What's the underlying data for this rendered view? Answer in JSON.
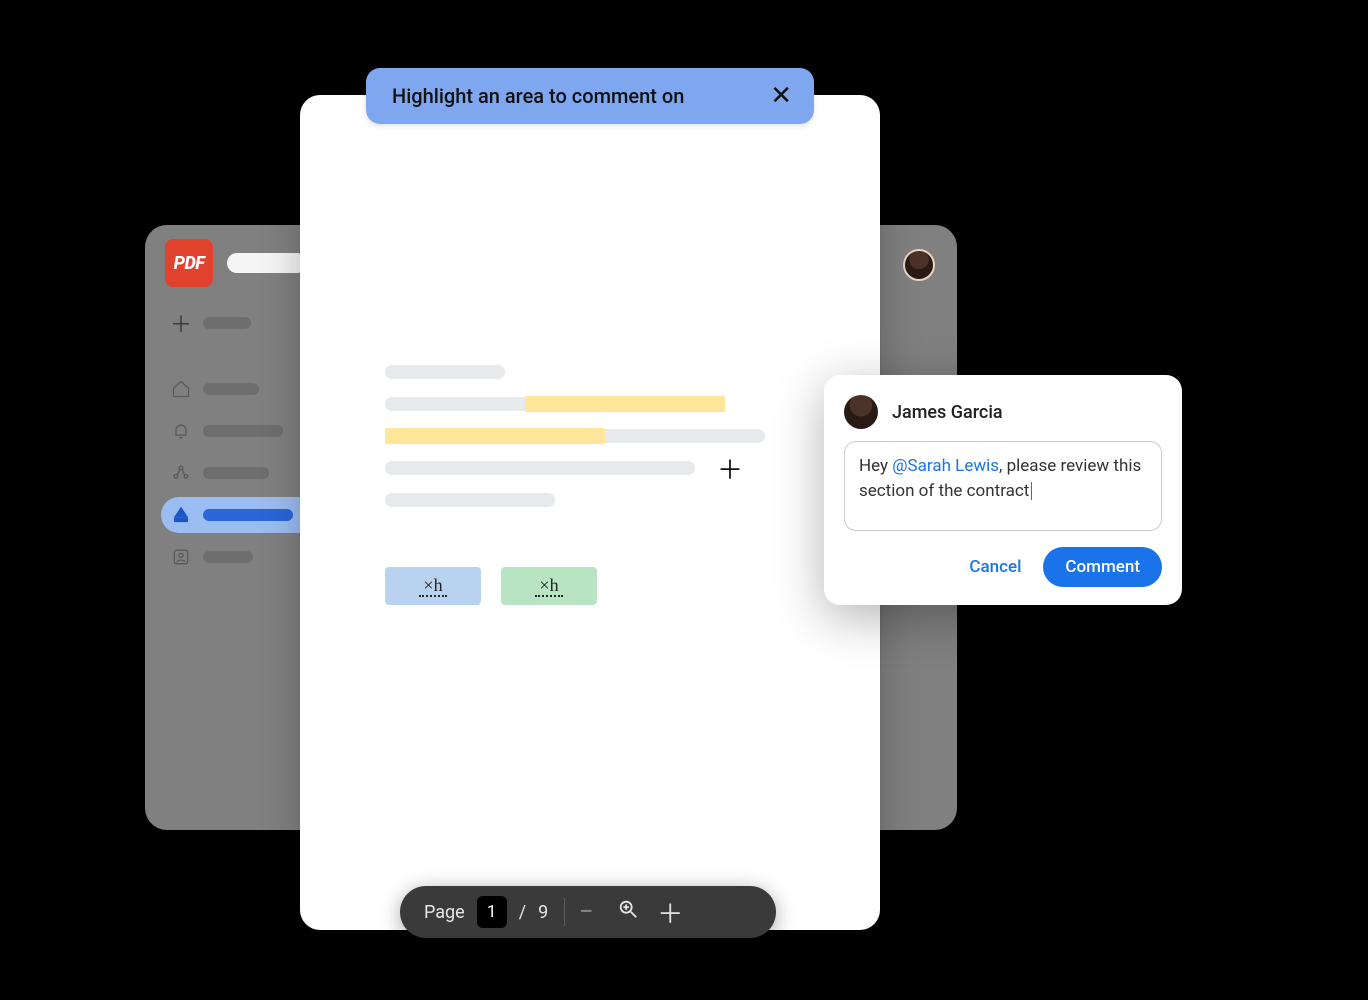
{
  "banner": {
    "text": "Highlight an area to comment on",
    "close_aria": "Close"
  },
  "app": {
    "badge": "PDF"
  },
  "comment": {
    "author": "James Garcia",
    "text_before": "Hey ",
    "mention": "@Sarah Lewis",
    "text_after": ", please review this section of the contract",
    "cancel": "Cancel",
    "submit": "Comment"
  },
  "toolbar": {
    "page_label": "Page",
    "current_page": "1",
    "separator": "/",
    "total_pages": "9"
  },
  "signatures": {
    "glyph": "×h"
  }
}
